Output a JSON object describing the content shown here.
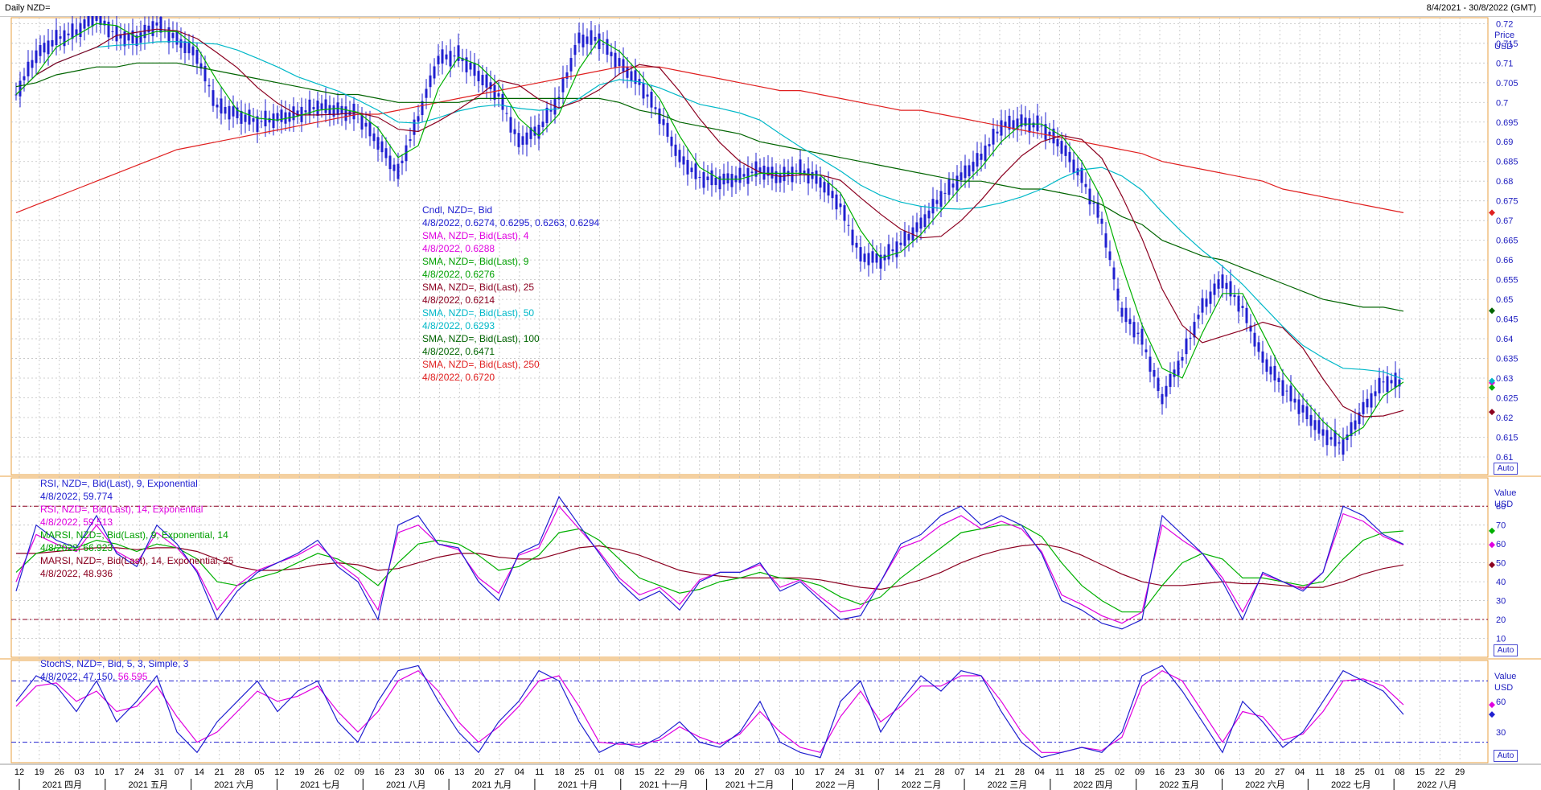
{
  "window": {
    "title": "Daily NZD=",
    "range": "8/4/2021 - 30/8/2022 (GMT)"
  },
  "colors": {
    "candle": "#2020d0",
    "sma4": "#e000e0",
    "sma9": "#00b000",
    "sma25": "#8b0020",
    "sma50": "#00b8c8",
    "sma100": "#006400",
    "sma250": "#e02020",
    "rsi9": "#2020d0",
    "rsi14": "#e000e0",
    "marsi9": "#00b000",
    "marsi14": "#8b0020",
    "stochK": "#2020d0",
    "stochD": "#e000e0",
    "grid": "#c0c0c0",
    "frame": "#e8a040"
  },
  "price_legend": [
    {
      "text": "Cndl, NZD=, Bid",
      "color": "#2020d0"
    },
    {
      "text": "4/8/2022, 0.6274, 0.6295, 0.6263, 0.6294",
      "color": "#2020d0"
    },
    {
      "text": "SMA, NZD=, Bid(Last),  4",
      "color": "#e000e0"
    },
    {
      "text": "4/8/2022, 0.6288",
      "color": "#e000e0"
    },
    {
      "text": "SMA, NZD=, Bid(Last),  9",
      "color": "#00a000"
    },
    {
      "text": "4/8/2022, 0.6276",
      "color": "#00a000"
    },
    {
      "text": "SMA, NZD=, Bid(Last),  25",
      "color": "#8b0020"
    },
    {
      "text": "4/8/2022, 0.6214",
      "color": "#8b0020"
    },
    {
      "text": "SMA, NZD=, Bid(Last),  50",
      "color": "#00b8c8"
    },
    {
      "text": "4/8/2022, 0.6293",
      "color": "#00b8c8"
    },
    {
      "text": "SMA, NZD=, Bid(Last),  100",
      "color": "#006400"
    },
    {
      "text": "4/8/2022, 0.6471",
      "color": "#006400"
    },
    {
      "text": "SMA, NZD=, Bid(Last),  250",
      "color": "#e02020"
    },
    {
      "text": "4/8/2022, 0.6720",
      "color": "#e02020"
    }
  ],
  "rsi_legend": [
    {
      "text": "RSI, NZD=, Bid(Last),  9, Exponential",
      "color": "#2020d0"
    },
    {
      "text": "4/8/2022, 59.774",
      "color": "#2020d0"
    },
    {
      "text": "RSI, NZD=, Bid(Last),  14, Exponential",
      "color": "#e000e0"
    },
    {
      "text": "4/8/2022, 59.513",
      "color": "#e000e0"
    },
    {
      "text": "MARSI, NZD=, Bid(Last),  9, Exponential, 14",
      "color": "#00a000"
    },
    {
      "text": "4/8/2022, 66.923",
      "color": "#00a000"
    },
    {
      "text": "MARSI, NZD=, Bid(Last),  14, Exponential, 25",
      "color": "#8b0020"
    },
    {
      "text": "4/8/2022, 48.936",
      "color": "#8b0020"
    }
  ],
  "stoch_legend": [
    {
      "text": "StochS, NZD=, Bid,  5, 3, Simple, 3",
      "color": "#2020d0"
    },
    {
      "text": "4/8/2022, 47.150, ",
      "color": "#2020d0"
    },
    {
      "text": "56.595",
      "color": "#e000e0"
    }
  ],
  "axis_titles": {
    "price": "Price",
    "price_unit": "USD",
    "value": "Value",
    "value_unit": "USD",
    "auto": "Auto"
  },
  "x_axis": {
    "day_labels": [
      "12",
      "19",
      "26",
      "03",
      "10",
      "17",
      "24",
      "31",
      "07",
      "14",
      "21",
      "28",
      "05",
      "12",
      "19",
      "26",
      "02",
      "09",
      "16",
      "23",
      "30",
      "06",
      "13",
      "20",
      "27",
      "04",
      "11",
      "18",
      "25",
      "01",
      "08",
      "15",
      "22",
      "29",
      "06",
      "13",
      "20",
      "27",
      "03",
      "10",
      "17",
      "24",
      "31",
      "07",
      "14",
      "21",
      "28",
      "07",
      "14",
      "21",
      "28",
      "04",
      "11",
      "18",
      "25",
      "02",
      "09",
      "16",
      "23",
      "30",
      "06",
      "13",
      "20",
      "27",
      "04",
      "11",
      "18",
      "25",
      "01",
      "08",
      "15",
      "22",
      "29"
    ],
    "month_labels": [
      "2021 四月",
      "2021 五月",
      "2021 六月",
      "2021 七月",
      "2021 八月",
      "2021 九月",
      "2021 十月",
      "2021 十一月",
      "2021 十二月",
      "2022 一月",
      "2022 二月",
      "2022 三月",
      "2022 四月",
      "2022 五月",
      "2022 六月",
      "2022 七月",
      "2022 八月"
    ]
  },
  "chart_data": [
    {
      "type": "candlestick",
      "title": "Daily NZD=",
      "ylabel": "Price USD",
      "ylim": [
        0.6055,
        0.7215
      ],
      "yticks": [
        0.61,
        0.615,
        0.62,
        0.625,
        0.63,
        0.635,
        0.64,
        0.645,
        0.65,
        0.655,
        0.66,
        0.665,
        0.67,
        0.675,
        0.68,
        0.685,
        0.69,
        0.695,
        0.7,
        0.705,
        0.71,
        0.715,
        0.72
      ],
      "x_range": [
        "2021-04-08",
        "2022-08-30"
      ],
      "series_close_weekly": [
        {
          "name": "Cndl, NZD=, Bid",
          "x": [
            "2021-04-09",
            "2021-04-16",
            "2021-04-23",
            "2021-04-30",
            "2021-05-07",
            "2021-05-14",
            "2021-05-21",
            "2021-05-28",
            "2021-06-04",
            "2021-06-11",
            "2021-06-18",
            "2021-06-25",
            "2021-07-02",
            "2021-07-09",
            "2021-07-16",
            "2021-07-23",
            "2021-07-30",
            "2021-08-06",
            "2021-08-13",
            "2021-08-20",
            "2021-08-27",
            "2021-09-03",
            "2021-09-10",
            "2021-09-17",
            "2021-09-24",
            "2021-10-01",
            "2021-10-08",
            "2021-10-15",
            "2021-10-22",
            "2021-10-29",
            "2021-11-05",
            "2021-11-12",
            "2021-11-19",
            "2021-11-26",
            "2021-12-03",
            "2021-12-10",
            "2021-12-17",
            "2021-12-24",
            "2021-12-31",
            "2022-01-07",
            "2022-01-14",
            "2022-01-21",
            "2022-01-28",
            "2022-02-04",
            "2022-02-11",
            "2022-02-18",
            "2022-02-25",
            "2022-03-04",
            "2022-03-11",
            "2022-03-18",
            "2022-03-25",
            "2022-04-01",
            "2022-04-08",
            "2022-04-15",
            "2022-04-22",
            "2022-04-29",
            "2022-05-06",
            "2022-05-13",
            "2022-05-20",
            "2022-05-27",
            "2022-06-03",
            "2022-06-10",
            "2022-06-17",
            "2022-06-24",
            "2022-07-01",
            "2022-07-08",
            "2022-07-15",
            "2022-07-22",
            "2022-07-29",
            "2022-08-04"
          ],
          "values": [
            0.702,
            0.712,
            0.716,
            0.718,
            0.722,
            0.717,
            0.716,
            0.72,
            0.716,
            0.712,
            0.699,
            0.697,
            0.695,
            0.696,
            0.697,
            0.699,
            0.698,
            0.697,
            0.69,
            0.682,
            0.696,
            0.711,
            0.712,
            0.707,
            0.702,
            0.69,
            0.693,
            0.701,
            0.716,
            0.716,
            0.71,
            0.705,
            0.697,
            0.686,
            0.681,
            0.68,
            0.681,
            0.683,
            0.681,
            0.683,
            0.68,
            0.674,
            0.661,
            0.66,
            0.664,
            0.669,
            0.676,
            0.681,
            0.686,
            0.694,
            0.695,
            0.694,
            0.689,
            0.681,
            0.67,
            0.647,
            0.64,
            0.625,
            0.635,
            0.648,
            0.655,
            0.648,
            0.635,
            0.628,
            0.622,
            0.616,
            0.613,
            0.622,
            0.629,
            0.629
          ]
        }
      ],
      "sma_latest": [
        {
          "name": "SMA, NZD=, Bid(Last),  4",
          "value": 0.6288
        },
        {
          "name": "SMA, NZD=, Bid(Last),  9",
          "value": 0.6276
        },
        {
          "name": "SMA, NZD=, Bid(Last),  25",
          "value": 0.6214
        },
        {
          "name": "SMA, NZD=, Bid(Last),  50",
          "value": 0.6293
        },
        {
          "name": "SMA, NZD=, Bid(Last),  100",
          "value": 0.6471
        },
        {
          "name": "SMA, NZD=, Bid(Last),  250",
          "value": 0.672
        }
      ],
      "sma100_weekly": [
        0.704,
        0.705,
        0.707,
        0.708,
        0.709,
        0.709,
        0.71,
        0.71,
        0.71,
        0.709,
        0.708,
        0.707,
        0.706,
        0.705,
        0.704,
        0.703,
        0.702,
        0.702,
        0.701,
        0.7,
        0.7,
        0.7,
        0.7,
        0.701,
        0.701,
        0.701,
        0.701,
        0.701,
        0.701,
        0.701,
        0.7,
        0.698,
        0.697,
        0.695,
        0.694,
        0.693,
        0.692,
        0.69,
        0.689,
        0.688,
        0.687,
        0.686,
        0.685,
        0.684,
        0.683,
        0.682,
        0.681,
        0.68,
        0.68,
        0.679,
        0.678,
        0.678,
        0.677,
        0.676,
        0.674,
        0.671,
        0.669,
        0.665,
        0.663,
        0.661,
        0.66,
        0.658,
        0.656,
        0.654,
        0.652,
        0.65,
        0.649,
        0.648,
        0.648,
        0.647
      ],
      "sma250_weekly": [
        0.672,
        0.674,
        0.676,
        0.678,
        0.68,
        0.682,
        0.684,
        0.686,
        0.688,
        0.689,
        0.69,
        0.691,
        0.692,
        0.693,
        0.694,
        0.695,
        0.696,
        0.697,
        0.697,
        0.698,
        0.699,
        0.7,
        0.701,
        0.702,
        0.703,
        0.704,
        0.705,
        0.706,
        0.707,
        0.708,
        0.709,
        0.709,
        0.709,
        0.708,
        0.707,
        0.706,
        0.705,
        0.704,
        0.703,
        0.703,
        0.702,
        0.701,
        0.7,
        0.699,
        0.698,
        0.698,
        0.697,
        0.696,
        0.695,
        0.694,
        0.693,
        0.692,
        0.691,
        0.69,
        0.689,
        0.688,
        0.687,
        0.685,
        0.684,
        0.683,
        0.682,
        0.681,
        0.68,
        0.678,
        0.677,
        0.676,
        0.675,
        0.674,
        0.673,
        0.672
      ]
    },
    {
      "type": "line",
      "title": "RSI",
      "ylabel": "Value USD",
      "ylim": [
        0,
        95
      ],
      "yticks": [
        10,
        20,
        30,
        40,
        50,
        60,
        70,
        80
      ],
      "bands": [
        20,
        80
      ],
      "latest": {
        "RSI 9": 59.774,
        "RSI 14": 59.513,
        "MARSI 9": 66.923,
        "MARSI 14": 48.936
      },
      "rsi9_weekly": [
        35,
        70,
        62,
        58,
        75,
        55,
        48,
        70,
        60,
        45,
        20,
        35,
        45,
        50,
        55,
        62,
        48,
        40,
        20,
        70,
        75,
        60,
        58,
        40,
        30,
        55,
        60,
        85,
        70,
        55,
        40,
        30,
        35,
        25,
        40,
        45,
        45,
        50,
        35,
        40,
        30,
        20,
        22,
        40,
        60,
        65,
        75,
        80,
        70,
        75,
        70,
        55,
        30,
        25,
        18,
        15,
        20,
        75,
        65,
        55,
        40,
        20,
        45,
        40,
        35,
        45,
        80,
        75,
        65,
        59.8
      ],
      "rsi14_weekly": [
        40,
        65,
        60,
        56,
        70,
        56,
        50,
        66,
        58,
        46,
        25,
        38,
        46,
        50,
        54,
        60,
        50,
        42,
        25,
        66,
        70,
        60,
        57,
        42,
        34,
        54,
        58,
        80,
        68,
        56,
        42,
        33,
        37,
        28,
        41,
        45,
        45,
        49,
        37,
        41,
        32,
        24,
        26,
        40,
        58,
        62,
        70,
        75,
        68,
        72,
        68,
        56,
        33,
        28,
        22,
        18,
        24,
        70,
        62,
        55,
        42,
        24,
        44,
        40,
        36,
        45,
        76,
        72,
        64,
        59.5
      ],
      "marsi9_weekly": [
        45,
        55,
        58,
        58,
        62,
        60,
        56,
        60,
        58,
        52,
        40,
        38,
        42,
        45,
        50,
        55,
        52,
        46,
        38,
        50,
        60,
        62,
        60,
        54,
        46,
        48,
        54,
        66,
        68,
        62,
        52,
        42,
        38,
        34,
        36,
        40,
        42,
        45,
        42,
        41,
        38,
        32,
        28,
        32,
        42,
        50,
        58,
        66,
        68,
        70,
        70,
        64,
        50,
        38,
        30,
        24,
        24,
        38,
        50,
        55,
        52,
        42,
        42,
        40,
        38,
        40,
        52,
        62,
        66,
        66.9
      ],
      "marsi14_weekly": [
        55,
        55,
        56,
        57,
        58,
        58,
        57,
        58,
        58,
        56,
        52,
        48,
        46,
        46,
        47,
        49,
        50,
        49,
        46,
        47,
        50,
        53,
        55,
        55,
        53,
        52,
        52,
        55,
        58,
        59,
        57,
        54,
        50,
        46,
        44,
        43,
        42,
        42,
        42,
        42,
        41,
        39,
        37,
        36,
        38,
        41,
        45,
        50,
        54,
        57,
        59,
        60,
        58,
        54,
        49,
        44,
        40,
        38,
        38,
        39,
        40,
        39,
        39,
        38,
        37,
        37,
        40,
        44,
        47,
        48.9
      ]
    },
    {
      "type": "line",
      "title": "StochS",
      "ylabel": "Value USD",
      "ylim": [
        0,
        100
      ],
      "yticks": [
        30,
        60
      ],
      "bands": [
        20,
        80
      ],
      "latest": {
        "%K": 47.15,
        "%D": 56.595
      },
      "stochK_weekly": [
        60,
        85,
        75,
        50,
        80,
        40,
        60,
        85,
        30,
        10,
        40,
        60,
        80,
        50,
        70,
        80,
        40,
        20,
        60,
        90,
        95,
        60,
        30,
        10,
        40,
        60,
        90,
        80,
        40,
        10,
        20,
        15,
        25,
        40,
        20,
        15,
        30,
        60,
        20,
        10,
        5,
        60,
        80,
        30,
        60,
        85,
        70,
        90,
        85,
        50,
        20,
        5,
        10,
        15,
        10,
        30,
        85,
        95,
        70,
        40,
        10,
        60,
        40,
        15,
        30,
        60,
        90,
        80,
        70,
        47.2
      ],
      "stochD_weekly": [
        55,
        75,
        78,
        60,
        70,
        50,
        55,
        75,
        45,
        20,
        30,
        50,
        70,
        60,
        65,
        75,
        50,
        30,
        50,
        80,
        90,
        70,
        40,
        20,
        35,
        55,
        80,
        85,
        55,
        20,
        18,
        18,
        22,
        35,
        25,
        18,
        28,
        50,
        30,
        15,
        10,
        45,
        70,
        40,
        55,
        75,
        75,
        85,
        85,
        60,
        30,
        10,
        10,
        15,
        12,
        25,
        75,
        90,
        80,
        50,
        20,
        50,
        45,
        22,
        28,
        50,
        80,
        82,
        75,
        56.6
      ]
    }
  ]
}
